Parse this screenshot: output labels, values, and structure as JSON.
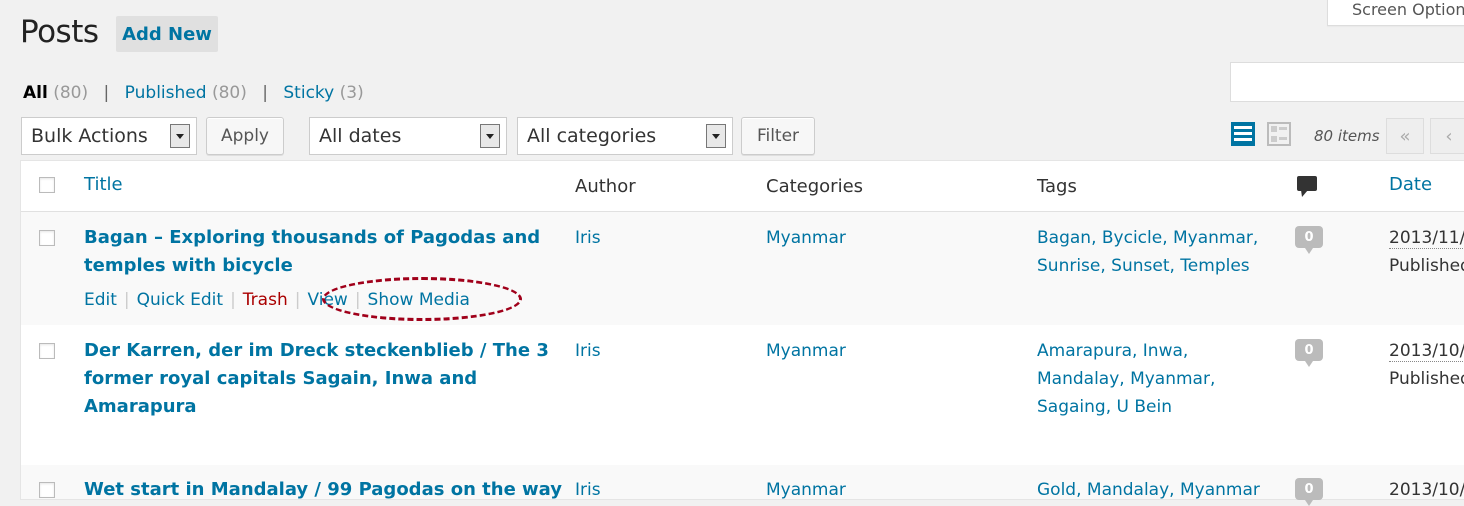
{
  "header": {
    "title": "Posts",
    "add_new": "Add New",
    "screen_options": "Screen Options"
  },
  "filters": {
    "all_label": "All",
    "all_count": "(80)",
    "published_label": "Published",
    "published_count": "(80)",
    "sticky_label": "Sticky",
    "sticky_count": "(3)",
    "separator": "|"
  },
  "tablenav": {
    "bulk_actions": "Bulk Actions",
    "apply": "Apply",
    "dates": "All dates",
    "categories": "All categories",
    "filter": "Filter",
    "items": "80 items",
    "first": "«",
    "prev": "‹"
  },
  "columns": {
    "title": "Title",
    "author": "Author",
    "categories": "Categories",
    "tags": "Tags",
    "date": "Date"
  },
  "row_actions": {
    "edit": "Edit",
    "quick_edit": "Quick Edit",
    "trash": "Trash",
    "view": "View",
    "show_media": "Show Media",
    "sep": "|"
  },
  "posts": [
    {
      "title_line1": "Bagan – Exploring thousands of Pagodas and",
      "title_line2": "temples with bicycle",
      "title_line3": "",
      "author": "Iris",
      "category": "Myanmar",
      "tags_line1": "Bagan, Bycicle, Myanmar,",
      "tags_line2": "Sunrise, Sunset, Temples",
      "tags_line3": "",
      "comments": "0",
      "date": "2013/11/",
      "status": "Published"
    },
    {
      "title_line1": "Der Karren, der im Dreck steckenblieb / The 3",
      "title_line2": "former royal capitals Sagain, Inwa and",
      "title_line3": "Amarapura",
      "author": "Iris",
      "category": "Myanmar",
      "tags_line1": "Amarapura, Inwa,",
      "tags_line2": "Mandalay, Myanmar,",
      "tags_line3": "Sagaing, U Bein",
      "comments": "0",
      "date": "2013/10/",
      "status": "Published"
    },
    {
      "title_line1": "Wet start in Mandalay / 99 Pagodas on the way",
      "author": "Iris",
      "category": "Myanmar",
      "tags_line1": "Gold, Mandalay, Myanmar",
      "comments": "0",
      "date": "2013/10/"
    }
  ],
  "colors": {
    "link": "#0074a2",
    "trash": "#aa0000",
    "highlight": "#a0001a",
    "view_icon_active": "#0074a2"
  }
}
